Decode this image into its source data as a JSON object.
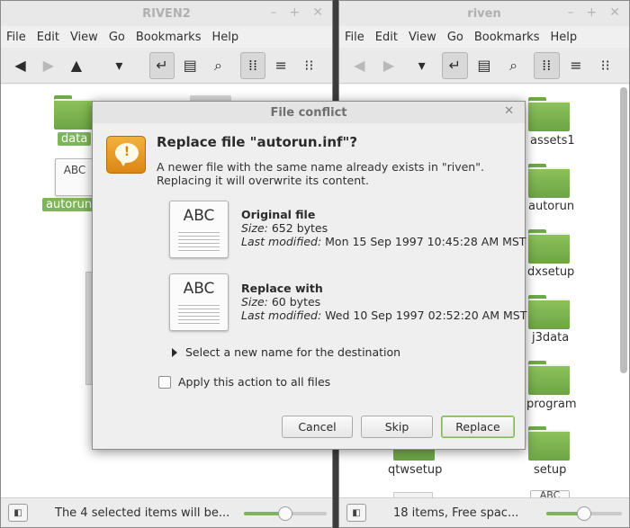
{
  "colors": {
    "accent": "#7fb55a",
    "folder": "#8cc15a",
    "warning": "#e39a25"
  },
  "menu": [
    "File",
    "Edit",
    "View",
    "Go",
    "Bookmarks",
    "Help"
  ],
  "left_window": {
    "title": "RIVEN2",
    "items": [
      {
        "name": "data",
        "icon": "folder-icon",
        "selected": true
      },
      {
        "name": "autorun.inf",
        "label": "autorun.",
        "icon": "text-file-icon",
        "selected": true
      }
    ],
    "status": "The 4 selected items will be..."
  },
  "right_window": {
    "title": "riven",
    "items": [
      "assets1",
      "autorun",
      "dxsetup",
      "j3data",
      "program",
      "qtwsetup",
      "setup"
    ],
    "status": "18 items, Free spac..."
  },
  "file_icon_text": "ABC",
  "zoom_level": 0.5,
  "dialog": {
    "title": "File conflict",
    "heading": "Replace file \"autorun.inf\"?",
    "message": "A newer file with the same name already exists in \"riven\". Replacing it will overwrite its content.",
    "size_label": "Size:",
    "modified_label": "Last modified:",
    "original": {
      "label": "Original file",
      "size": "652 bytes",
      "modified": "Mon 15 Sep 1997 10:45:28 AM MST"
    },
    "replacement": {
      "label": "Replace with",
      "size": "60 bytes",
      "modified": "Wed 10 Sep 1997 02:52:20 AM MST"
    },
    "expander_label": "Select a new name for the destination",
    "apply_all_label": "Apply this action to all files",
    "apply_all_checked": false,
    "buttons": {
      "cancel": "Cancel",
      "skip": "Skip",
      "replace": "Replace"
    }
  }
}
